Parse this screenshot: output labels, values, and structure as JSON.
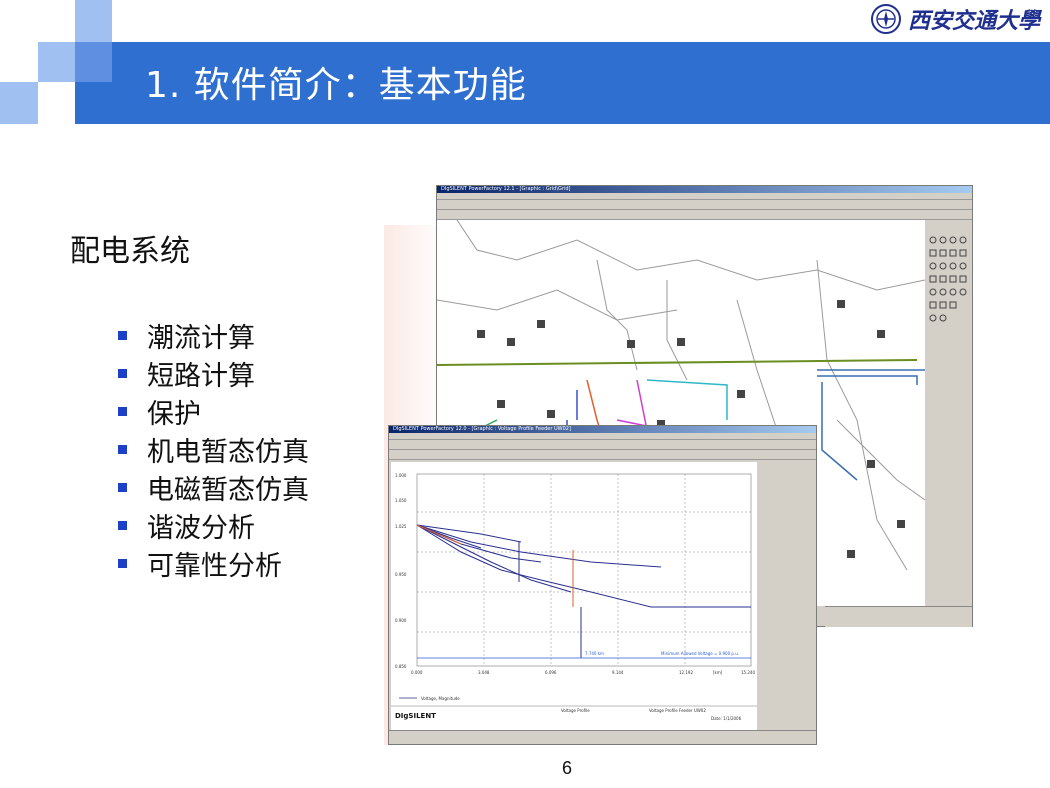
{
  "slide": {
    "title": "1. 软件简介：基本功能",
    "logo_text": "西安交通大學",
    "heading": "配电系统",
    "bullets": [
      "潮流计算",
      "短路计算",
      "保护",
      "机电暂态仿真",
      "电磁暂态仿真",
      "谐波分析",
      "可靠性分析"
    ],
    "page_number": "6"
  },
  "screenshot": {
    "back_window_title": "DIgSILENT PowerFactory 12.1 - [Graphic : Grid\\Grid]",
    "front_window_title": "DIgSILENT PowerFactory 12.0 - [Graphic : Voltage Profile Feeder UW02]",
    "brand": "DIgSILENT",
    "chart_footer_left": "Voltage Profile",
    "chart_footer_mid": "Voltage Profile Feeder UW02",
    "chart_footer_right": "Date: 1/1/2006",
    "legend_entry": "Voltage, Magnitude",
    "annotation_left": "7.740 km",
    "annotation_right": "Minimum Allowed Voltage = 0.900 p.u.",
    "y_ticks": [
      "1.000",
      "1.050",
      "1.025",
      "0.950",
      "0.900",
      "0.850"
    ],
    "x_ticks": [
      "0.000",
      "3.048",
      "6.096",
      "9.144",
      "12.192",
      "15.240"
    ],
    "x_unit": "[km]",
    "colors": {
      "title_bar": "#2f6fd0",
      "bullet": "#1e3fc8",
      "accent_light": "#9fc0f0"
    }
  }
}
